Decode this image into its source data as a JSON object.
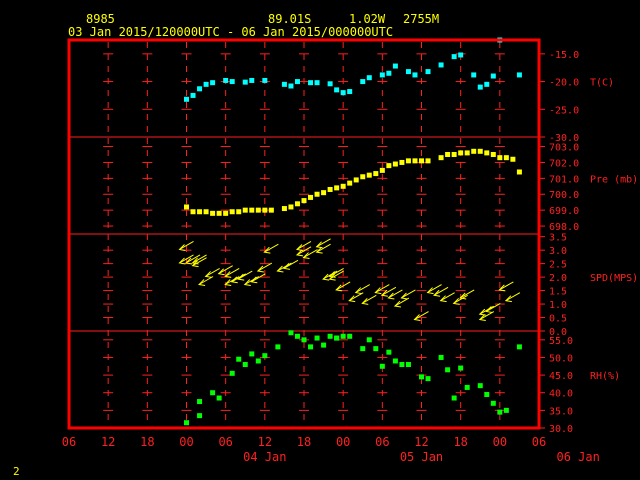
{
  "header": {
    "station_id": "8985",
    "lat": "89.01S",
    "lon": "1.02W",
    "elev": "2755M",
    "time_range": "03 Jan 2015/120000UTC - 06 Jan 2015/000000UTC"
  },
  "footer": {
    "page_number": "2"
  },
  "colors": {
    "frame": "#ff0000",
    "grid": "#ff2020",
    "header_text": "#ffff00",
    "temperature": "#00ffff",
    "pressure": "#ffff00",
    "wind": "#ffff00",
    "humidity": "#00ff00"
  },
  "x_axis": {
    "tick_labels": [
      "06",
      "12",
      "18",
      "00",
      "06",
      "12",
      "18",
      "00",
      "06",
      "12",
      "18",
      "00",
      "06"
    ],
    "day_labels": [
      "04 Jan",
      "05 Jan",
      "06 Jan"
    ],
    "range_hours": [
      -6,
      66
    ]
  },
  "chart_data": [
    {
      "type": "scatter",
      "ylabel": "T(C)",
      "ylim": [
        -30,
        -12.5
      ],
      "yticks": [
        "-15.0",
        "-20.0",
        "-25.0",
        "-30.0"
      ],
      "ytick_values": [
        -15,
        -20,
        -25,
        -30
      ],
      "x_unit": "hours since 03 Jan 2015 00UTC",
      "x": [
        12,
        13,
        14,
        15,
        16,
        18,
        19,
        21,
        22,
        24,
        27,
        28,
        29,
        31,
        32,
        34,
        35,
        36,
        37,
        39,
        40,
        42,
        43,
        44,
        46,
        47,
        49,
        51,
        53,
        54,
        56,
        57,
        58,
        59,
        60,
        63
      ],
      "y": [
        -23.2,
        -22.5,
        -21.3,
        -20.5,
        -20.2,
        -19.8,
        -20,
        -20.1,
        -19.8,
        -19.8,
        -20.5,
        -20.8,
        -20,
        -20.2,
        -20.2,
        -20.4,
        -21.5,
        -22,
        -21.8,
        -20,
        -19.3,
        -18.8,
        -18.5,
        -17.2,
        -18.2,
        -18.8,
        -18.2,
        -17,
        -15.5,
        -15.2,
        -18.8,
        -21,
        -20.5,
        -19,
        -12.5,
        -18.8
      ]
    },
    {
      "type": "scatter",
      "ylabel": "Pre (mb)",
      "ylim": [
        697.5,
        703.6
      ],
      "yticks": [
        "703.0",
        "702.0",
        "701.0",
        "700.0",
        "699.0",
        "698.0"
      ],
      "ytick_values": [
        703,
        702,
        701,
        700,
        699,
        698
      ],
      "x": [
        12,
        13,
        14,
        15,
        16,
        17,
        18,
        19,
        20,
        21,
        22,
        23,
        24,
        25,
        27,
        28,
        29,
        30,
        31,
        32,
        33,
        34,
        35,
        36,
        37,
        38,
        39,
        40,
        41,
        42,
        43,
        44,
        45,
        46,
        47,
        48,
        49,
        51,
        52,
        53,
        54,
        55,
        56,
        57,
        58,
        59,
        60,
        61,
        62,
        63
      ],
      "y": [
        699.2,
        698.9,
        698.9,
        698.9,
        698.8,
        698.8,
        698.8,
        698.9,
        698.9,
        699,
        699,
        699,
        699,
        699,
        699.1,
        699.2,
        699.4,
        699.6,
        699.8,
        700,
        700.1,
        700.3,
        700.4,
        700.5,
        700.7,
        700.9,
        701.1,
        701.2,
        701.3,
        701.5,
        701.8,
        701.9,
        702,
        702.1,
        702.1,
        702.1,
        702.1,
        702.3,
        702.5,
        702.5,
        702.6,
        702.6,
        702.7,
        702.7,
        702.6,
        702.5,
        702.3,
        702.3,
        702.2,
        701.4
      ]
    },
    {
      "type": "scatter",
      "ylabel": "SPD(MPS)",
      "ylim": [
        0,
        3.6
      ],
      "yticks": [
        "3.5",
        "3.0",
        "2.5",
        "2.0",
        "1.5",
        "1.0",
        "0.5",
        "0.0"
      ],
      "ytick_values": [
        3.5,
        3,
        2.5,
        2,
        1.5,
        1,
        0.5,
        0
      ],
      "x": [
        12,
        12,
        13,
        14,
        14,
        15,
        16,
        18,
        19,
        19,
        20,
        21,
        22,
        23,
        24,
        25,
        27,
        28,
        30,
        30,
        31,
        33,
        33,
        34,
        35,
        35,
        36,
        38,
        39,
        40,
        42,
        43,
        44,
        45,
        46,
        48,
        50,
        51,
        52,
        54,
        55,
        58,
        58,
        59,
        61,
        62
      ],
      "y": [
        3.1,
        2.6,
        2.6,
        2.5,
        2.6,
        1.8,
        2.1,
        2.2,
        2.1,
        1.8,
        1.9,
        2.0,
        1.8,
        1.9,
        2.3,
        3.0,
        2.3,
        2.4,
        2.9,
        3.1,
        2.8,
        3.0,
        3.2,
        2.0,
        2.0,
        2.1,
        1.6,
        1.2,
        1.5,
        1.1,
        1.5,
        1.4,
        1.3,
        1.0,
        1.3,
        0.5,
        1.5,
        1.4,
        1.2,
        1.1,
        1.3,
        0.5,
        0.7,
        0.8,
        1.6,
        1.2
      ]
    },
    {
      "type": "scatter",
      "ylabel": "RH(%)",
      "ylim": [
        30,
        57.5
      ],
      "yticks": [
        "55.0",
        "50.0",
        "45.0",
        "40.0",
        "35.0",
        "30.0"
      ],
      "ytick_values": [
        55,
        50,
        45,
        40,
        35,
        30
      ],
      "x": [
        12,
        14,
        14,
        16,
        17,
        19,
        20,
        21,
        22,
        23,
        24,
        26,
        28,
        29,
        30,
        31,
        32,
        33,
        34,
        35,
        35,
        36,
        37,
        39,
        40,
        41,
        42,
        43,
        44,
        45,
        46,
        48,
        49,
        51,
        52,
        53,
        54,
        55,
        57,
        58,
        59,
        60,
        61,
        63
      ],
      "y": [
        31.5,
        33.5,
        37.5,
        40,
        38.5,
        45.5,
        49.5,
        48,
        51,
        49,
        50.5,
        53,
        57,
        56,
        55,
        53,
        55.5,
        53.5,
        56,
        55.5,
        55.5,
        56,
        56,
        52.5,
        55,
        52.5,
        47.5,
        51.5,
        49,
        48,
        48,
        44.5,
        44,
        50,
        46.5,
        38.5,
        47,
        41.5,
        42,
        39.5,
        37,
        34.5,
        35,
        53
      ]
    }
  ]
}
